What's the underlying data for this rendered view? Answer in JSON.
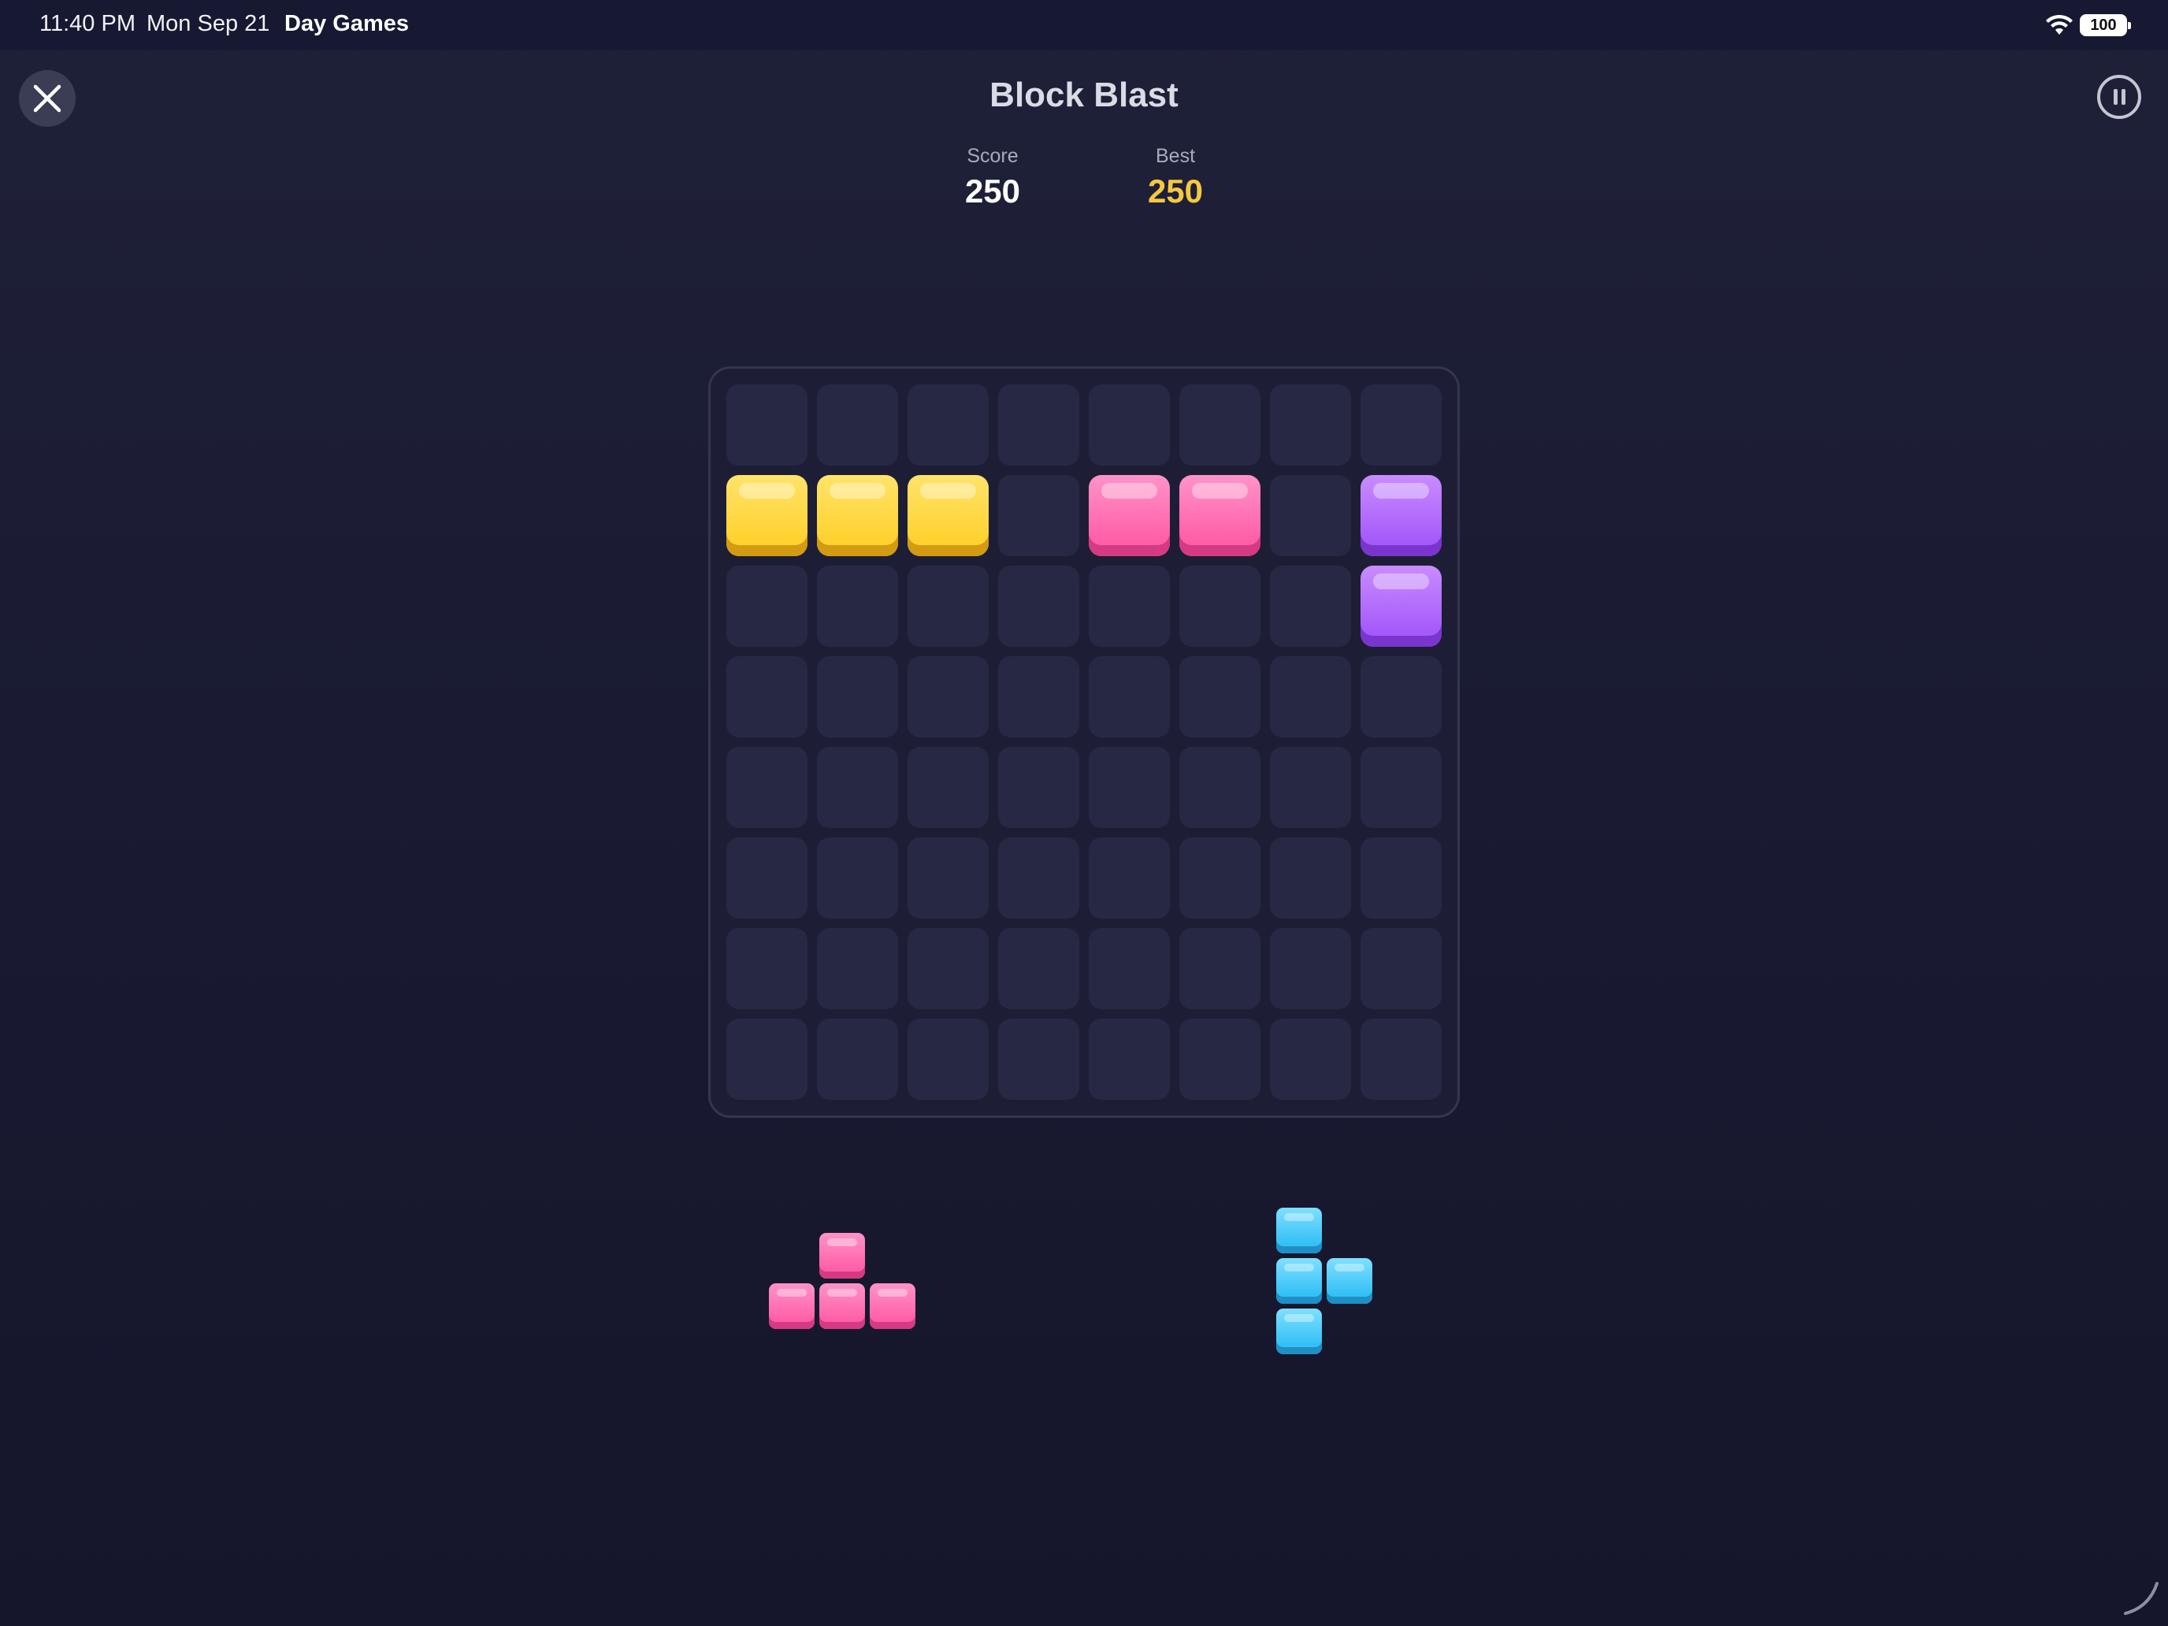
{
  "status_bar": {
    "time": "11:40 PM",
    "date": "Mon Sep 21",
    "app_name": "Day Games",
    "battery": "100",
    "wifi_icon": "wifi-icon"
  },
  "header": {
    "title": "Block Blast",
    "close_icon": "close-icon",
    "pause_icon": "pause-icon"
  },
  "stats": {
    "score_label": "Score",
    "score_value": "250",
    "best_label": "Best",
    "best_value": "250"
  },
  "colors": {
    "yellow": "#ffd230",
    "pink": "#ff5fa8",
    "purple": "#a55bfa",
    "cyan": "#33c0f5",
    "best_score": "#f5c842",
    "empty_cell": "#272944"
  },
  "board": {
    "rows": 8,
    "cols": 8,
    "grid": [
      [
        "",
        "",
        "",
        "",
        "",
        "",
        "",
        ""
      ],
      [
        "yellow",
        "yellow",
        "yellow",
        "",
        "pink",
        "pink",
        "",
        "purple"
      ],
      [
        "",
        "",
        "",
        "",
        "",
        "",
        "",
        "purple"
      ],
      [
        "",
        "",
        "",
        "",
        "",
        "",
        "",
        ""
      ],
      [
        "",
        "",
        "",
        "",
        "",
        "",
        "",
        ""
      ],
      [
        "",
        "",
        "",
        "",
        "",
        "",
        "",
        ""
      ],
      [
        "",
        "",
        "",
        "",
        "",
        "",
        "",
        ""
      ],
      [
        "",
        "",
        "",
        "",
        "",
        "",
        "",
        ""
      ]
    ]
  },
  "tray": [
    {
      "name": "tray-piece-pink-t",
      "color": "pink",
      "shape": [
        [
          0,
          1,
          0
        ],
        [
          1,
          1,
          1
        ]
      ]
    },
    {
      "name": "tray-piece-cyan-t",
      "color": "cyan",
      "shape": [
        [
          1,
          0
        ],
        [
          1,
          1
        ],
        [
          1,
          0
        ]
      ]
    }
  ]
}
